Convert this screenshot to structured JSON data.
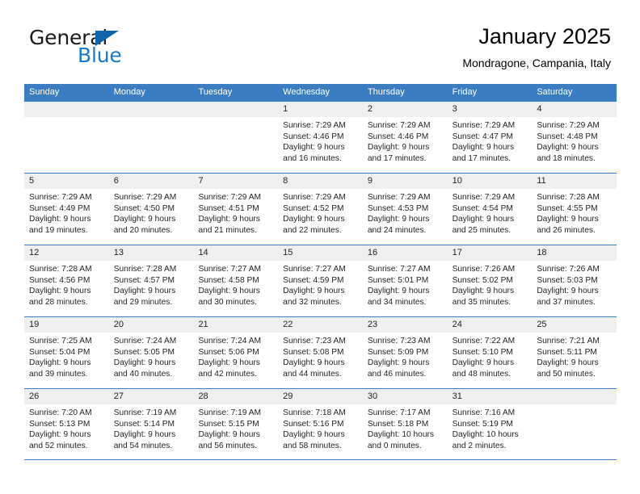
{
  "brand": {
    "name_top": "General",
    "name_bottom": "Blue",
    "triangle_icon": "blue-triangle-logo-icon",
    "color_dark": "#1a1a1a",
    "color_blue": "#1878c8"
  },
  "header": {
    "title": "January 2025",
    "subtitle": "Mondragone, Campania, Italy"
  },
  "colors": {
    "header_row_bg": "#3a7dc0",
    "day_number_bg": "#efefef",
    "text": "#231f20"
  },
  "weekdays": [
    "Sunday",
    "Monday",
    "Tuesday",
    "Wednesday",
    "Thursday",
    "Friday",
    "Saturday"
  ],
  "weeks": [
    [
      {
        "day": "",
        "lines": []
      },
      {
        "day": "",
        "lines": []
      },
      {
        "day": "",
        "lines": []
      },
      {
        "day": "1",
        "lines": [
          "Sunrise: 7:29 AM",
          "Sunset: 4:46 PM",
          "Daylight: 9 hours",
          "and 16 minutes."
        ]
      },
      {
        "day": "2",
        "lines": [
          "Sunrise: 7:29 AM",
          "Sunset: 4:46 PM",
          "Daylight: 9 hours",
          "and 17 minutes."
        ]
      },
      {
        "day": "3",
        "lines": [
          "Sunrise: 7:29 AM",
          "Sunset: 4:47 PM",
          "Daylight: 9 hours",
          "and 17 minutes."
        ]
      },
      {
        "day": "4",
        "lines": [
          "Sunrise: 7:29 AM",
          "Sunset: 4:48 PM",
          "Daylight: 9 hours",
          "and 18 minutes."
        ]
      }
    ],
    [
      {
        "day": "5",
        "lines": [
          "Sunrise: 7:29 AM",
          "Sunset: 4:49 PM",
          "Daylight: 9 hours",
          "and 19 minutes."
        ]
      },
      {
        "day": "6",
        "lines": [
          "Sunrise: 7:29 AM",
          "Sunset: 4:50 PM",
          "Daylight: 9 hours",
          "and 20 minutes."
        ]
      },
      {
        "day": "7",
        "lines": [
          "Sunrise: 7:29 AM",
          "Sunset: 4:51 PM",
          "Daylight: 9 hours",
          "and 21 minutes."
        ]
      },
      {
        "day": "8",
        "lines": [
          "Sunrise: 7:29 AM",
          "Sunset: 4:52 PM",
          "Daylight: 9 hours",
          "and 22 minutes."
        ]
      },
      {
        "day": "9",
        "lines": [
          "Sunrise: 7:29 AM",
          "Sunset: 4:53 PM",
          "Daylight: 9 hours",
          "and 24 minutes."
        ]
      },
      {
        "day": "10",
        "lines": [
          "Sunrise: 7:29 AM",
          "Sunset: 4:54 PM",
          "Daylight: 9 hours",
          "and 25 minutes."
        ]
      },
      {
        "day": "11",
        "lines": [
          "Sunrise: 7:28 AM",
          "Sunset: 4:55 PM",
          "Daylight: 9 hours",
          "and 26 minutes."
        ]
      }
    ],
    [
      {
        "day": "12",
        "lines": [
          "Sunrise: 7:28 AM",
          "Sunset: 4:56 PM",
          "Daylight: 9 hours",
          "and 28 minutes."
        ]
      },
      {
        "day": "13",
        "lines": [
          "Sunrise: 7:28 AM",
          "Sunset: 4:57 PM",
          "Daylight: 9 hours",
          "and 29 minutes."
        ]
      },
      {
        "day": "14",
        "lines": [
          "Sunrise: 7:27 AM",
          "Sunset: 4:58 PM",
          "Daylight: 9 hours",
          "and 30 minutes."
        ]
      },
      {
        "day": "15",
        "lines": [
          "Sunrise: 7:27 AM",
          "Sunset: 4:59 PM",
          "Daylight: 9 hours",
          "and 32 minutes."
        ]
      },
      {
        "day": "16",
        "lines": [
          "Sunrise: 7:27 AM",
          "Sunset: 5:01 PM",
          "Daylight: 9 hours",
          "and 34 minutes."
        ]
      },
      {
        "day": "17",
        "lines": [
          "Sunrise: 7:26 AM",
          "Sunset: 5:02 PM",
          "Daylight: 9 hours",
          "and 35 minutes."
        ]
      },
      {
        "day": "18",
        "lines": [
          "Sunrise: 7:26 AM",
          "Sunset: 5:03 PM",
          "Daylight: 9 hours",
          "and 37 minutes."
        ]
      }
    ],
    [
      {
        "day": "19",
        "lines": [
          "Sunrise: 7:25 AM",
          "Sunset: 5:04 PM",
          "Daylight: 9 hours",
          "and 39 minutes."
        ]
      },
      {
        "day": "20",
        "lines": [
          "Sunrise: 7:24 AM",
          "Sunset: 5:05 PM",
          "Daylight: 9 hours",
          "and 40 minutes."
        ]
      },
      {
        "day": "21",
        "lines": [
          "Sunrise: 7:24 AM",
          "Sunset: 5:06 PM",
          "Daylight: 9 hours",
          "and 42 minutes."
        ]
      },
      {
        "day": "22",
        "lines": [
          "Sunrise: 7:23 AM",
          "Sunset: 5:08 PM",
          "Daylight: 9 hours",
          "and 44 minutes."
        ]
      },
      {
        "day": "23",
        "lines": [
          "Sunrise: 7:23 AM",
          "Sunset: 5:09 PM",
          "Daylight: 9 hours",
          "and 46 minutes."
        ]
      },
      {
        "day": "24",
        "lines": [
          "Sunrise: 7:22 AM",
          "Sunset: 5:10 PM",
          "Daylight: 9 hours",
          "and 48 minutes."
        ]
      },
      {
        "day": "25",
        "lines": [
          "Sunrise: 7:21 AM",
          "Sunset: 5:11 PM",
          "Daylight: 9 hours",
          "and 50 minutes."
        ]
      }
    ],
    [
      {
        "day": "26",
        "lines": [
          "Sunrise: 7:20 AM",
          "Sunset: 5:13 PM",
          "Daylight: 9 hours",
          "and 52 minutes."
        ]
      },
      {
        "day": "27",
        "lines": [
          "Sunrise: 7:19 AM",
          "Sunset: 5:14 PM",
          "Daylight: 9 hours",
          "and 54 minutes."
        ]
      },
      {
        "day": "28",
        "lines": [
          "Sunrise: 7:19 AM",
          "Sunset: 5:15 PM",
          "Daylight: 9 hours",
          "and 56 minutes."
        ]
      },
      {
        "day": "29",
        "lines": [
          "Sunrise: 7:18 AM",
          "Sunset: 5:16 PM",
          "Daylight: 9 hours",
          "and 58 minutes."
        ]
      },
      {
        "day": "30",
        "lines": [
          "Sunrise: 7:17 AM",
          "Sunset: 5:18 PM",
          "Daylight: 10 hours",
          "and 0 minutes."
        ]
      },
      {
        "day": "31",
        "lines": [
          "Sunrise: 7:16 AM",
          "Sunset: 5:19 PM",
          "Daylight: 10 hours",
          "and 2 minutes."
        ]
      },
      {
        "day": "",
        "lines": []
      }
    ]
  ]
}
